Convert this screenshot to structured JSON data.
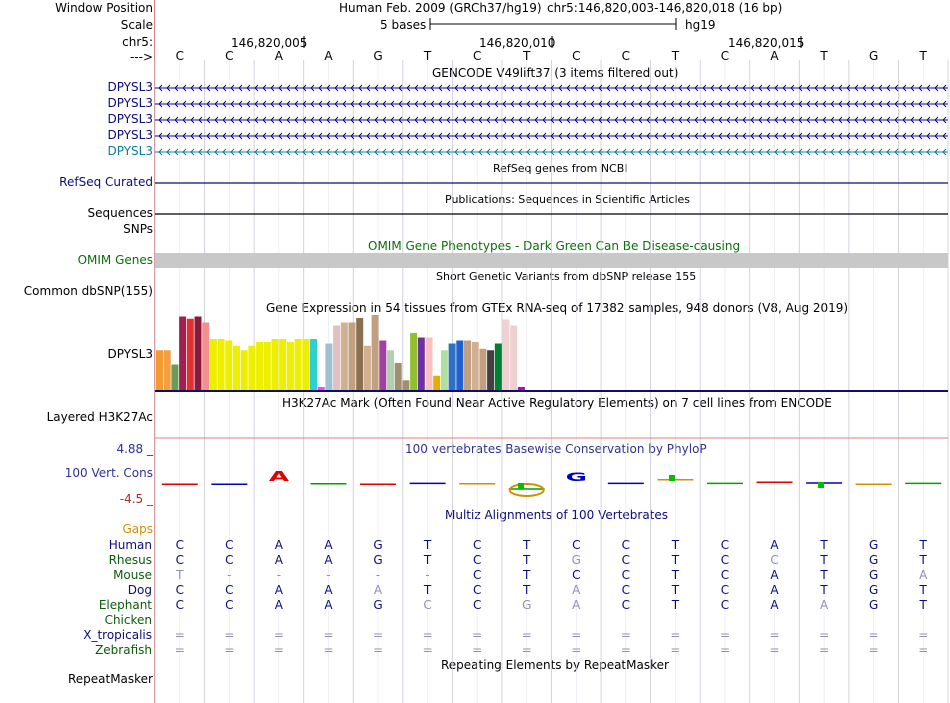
{
  "header": {
    "window_position_label": "Window Position",
    "assembly_text": "Human Feb. 2009 (GRCh37/hg19)",
    "position_text": "chr5:146,820,003-146,820,018 (16 bp)",
    "scale_label": "Scale",
    "scale_bar_text": "5 bases",
    "scale_assembly": "hg19",
    "chrom_label": "chr5:",
    "coord_ticks": [
      "146,820,005",
      "146,820,010",
      "146,820,015"
    ],
    "strand_label": "--->",
    "bases": [
      "C",
      "C",
      "A",
      "A",
      "G",
      "T",
      "C",
      "T",
      "C",
      "C",
      "T",
      "C",
      "A",
      "T",
      "G",
      "T"
    ]
  },
  "tracks": {
    "gencode": {
      "title": "GENCODE V49lift37 (3 items filtered out)",
      "items": [
        "DPYSL3",
        "DPYSL3",
        "DPYSL3",
        "DPYSL3",
        "DPYSL3"
      ],
      "colors": [
        "#0c0c78",
        "#0c0c78",
        "#0c0c78",
        "#0c0c78",
        "#0c7c96"
      ]
    },
    "refseq": {
      "title": "RefSeq genes from NCBI",
      "label": "RefSeq Curated",
      "color": "#0c0c78"
    },
    "pubs": {
      "title": "Publications: Sequences in Scientific Articles",
      "label": "Sequences"
    },
    "snps": {
      "label": "SNPs"
    },
    "omim": {
      "title": "OMIM Gene Phenotypes - Dark Green Can Be Disease-causing",
      "label": "OMIM Genes",
      "color": "#0a6e0a",
      "bar_color": "#c8c8c8"
    },
    "dbsnp": {
      "title": "Short Genetic Variants from dbSNP release 155",
      "label": "Common dbSNP(155)"
    },
    "gtex": {
      "title": "Gene Expression in 54 tissues from GTEx RNA-seq of 17382 samples, 948 donors (V8, Aug 2019)",
      "label": "DPYSL3",
      "bars": [
        {
          "v": 0.53,
          "c": "#f39b31"
        },
        {
          "v": 0.53,
          "c": "#f0a040"
        },
        {
          "v": 0.34,
          "c": "#6c9a5a"
        },
        {
          "v": 0.98,
          "c": "#a02050"
        },
        {
          "v": 0.95,
          "c": "#e03030"
        },
        {
          "v": 0.98,
          "c": "#8b1a3a"
        },
        {
          "v": 0.9,
          "c": "#f09090"
        },
        {
          "v": 0.68,
          "c": "#eeee00"
        },
        {
          "v": 0.68,
          "c": "#eeee00"
        },
        {
          "v": 0.66,
          "c": "#eeee00"
        },
        {
          "v": 0.59,
          "c": "#eeee00"
        },
        {
          "v": 0.53,
          "c": "#eeee00"
        },
        {
          "v": 0.59,
          "c": "#eeee00"
        },
        {
          "v": 0.64,
          "c": "#eeee00"
        },
        {
          "v": 0.64,
          "c": "#eeee00"
        },
        {
          "v": 0.68,
          "c": "#eeee00"
        },
        {
          "v": 0.68,
          "c": "#eeee00"
        },
        {
          "v": 0.64,
          "c": "#eeee00"
        },
        {
          "v": 0.68,
          "c": "#eeee00"
        },
        {
          "v": 0.68,
          "c": "#eeee00"
        },
        {
          "v": 0.68,
          "c": "#30d0d0"
        },
        {
          "v": 0.04,
          "c": "#ff40ff"
        },
        {
          "v": 0.62,
          "c": "#a0c0d0"
        },
        {
          "v": 0.86,
          "c": "#e0c0c0"
        },
        {
          "v": 0.9,
          "c": "#d0b090"
        },
        {
          "v": 0.9,
          "c": "#c0a080"
        },
        {
          "v": 0.96,
          "c": "#8b7050"
        },
        {
          "v": 0.59,
          "c": "#d0b090"
        },
        {
          "v": 1.0,
          "c": "#c0a080"
        },
        {
          "v": 0.66,
          "c": "#a040a0"
        },
        {
          "v": 0.53,
          "c": "#b0d0b0"
        },
        {
          "v": 0.36,
          "c": "#a09070"
        },
        {
          "v": 0.13,
          "c": "#a09070"
        },
        {
          "v": 0.76,
          "c": "#90c030"
        },
        {
          "v": 0.7,
          "c": "#7030a0"
        },
        {
          "v": 0.7,
          "c": "#fac0c0"
        },
        {
          "v": 0.19,
          "c": "#e0b000"
        },
        {
          "v": 0.53,
          "c": "#b0e0a0"
        },
        {
          "v": 0.62,
          "c": "#3070c0"
        },
        {
          "v": 0.66,
          "c": "#2060d0"
        },
        {
          "v": 0.66,
          "c": "#c0a080"
        },
        {
          "v": 0.64,
          "c": "#d0b090"
        },
        {
          "v": 0.55,
          "c": "#c0a080"
        },
        {
          "v": 0.53,
          "c": "#404040"
        },
        {
          "v": 0.62,
          "c": "#008030"
        },
        {
          "v": 0.94,
          "c": "#f0d0d0"
        },
        {
          "v": 0.86,
          "c": "#ecd0d0"
        },
        {
          "v": 0.04,
          "c": "#c000c0"
        }
      ]
    },
    "h3k27ac": {
      "title": "H3K27Ac Mark (Often Found Near Active Regulatory Elements) on 7 cell lines from ENCODE",
      "label": "Layered H3K27Ac"
    },
    "phylop": {
      "title": "100 vertebrates Basewise Conservation by PhyloP",
      "label": "100 Vert. Cons",
      "max": "4.88 _",
      "min": "-4.5 _",
      "color": "#303090",
      "scores": [
        -0.3,
        -0.3,
        1.6,
        -0.2,
        -0.3,
        -0.1,
        -0.2,
        -1.5,
        2.4,
        -0.1,
        0.8,
        -0.1,
        0.2,
        0.0,
        -0.3,
        -0.1
      ]
    },
    "multiz": {
      "title": "Multiz Alignments of 100 Vertebrates",
      "gaps_label": "Gaps",
      "species": [
        {
          "name": "Human",
          "color": "#0c0c78",
          "seq": [
            "C",
            "C",
            "A",
            "A",
            "G",
            "T",
            "C",
            "T",
            "C",
            "C",
            "T",
            "C",
            "A",
            "T",
            "G",
            "T"
          ],
          "dim": []
        },
        {
          "name": "Rhesus",
          "color": "#0c5a0c",
          "seq": [
            "C",
            "C",
            "A",
            "A",
            "G",
            "T",
            "C",
            "T",
            "G",
            "C",
            "T",
            "C",
            "C",
            "T",
            "G",
            "T"
          ],
          "dim": [
            8,
            12
          ]
        },
        {
          "name": "Mouse",
          "color": "#0c5a0c",
          "seq": [
            "T",
            "-",
            "-",
            "-",
            "-",
            "-",
            "C",
            "T",
            "C",
            "C",
            "T",
            "C",
            "A",
            "T",
            "G",
            "A"
          ],
          "dim": [
            0,
            1,
            2,
            3,
            4,
            5,
            15
          ]
        },
        {
          "name": "Dog",
          "color": "#0c0c78",
          "seq": [
            "C",
            "C",
            "A",
            "A",
            "A",
            "T",
            "C",
            "T",
            "A",
            "C",
            "T",
            "C",
            "A",
            "T",
            "G",
            "T"
          ],
          "dim": [
            4,
            8
          ]
        },
        {
          "name": "Elephant",
          "color": "#0c5a0c",
          "seq": [
            "C",
            "C",
            "A",
            "A",
            "G",
            "C",
            "C",
            "G",
            "A",
            "C",
            "T",
            "C",
            "A",
            "A",
            "G",
            "T"
          ],
          "dim": [
            5,
            7,
            8,
            13
          ]
        },
        {
          "name": "Chicken",
          "color": "#0c5a0c",
          "seq": [],
          "dim": []
        },
        {
          "name": "X_tropicalis",
          "color": "#0c0c78",
          "seq": [
            "=",
            "=",
            "=",
            "=",
            "=",
            "=",
            "=",
            "=",
            "=",
            "=",
            "=",
            "=",
            "=",
            "=",
            "=",
            "="
          ],
          "dim": [
            0,
            1,
            2,
            3,
            4,
            5,
            6,
            7,
            8,
            9,
            10,
            11,
            12,
            13,
            14,
            15
          ]
        },
        {
          "name": "Zebrafish",
          "color": "#0c5a0c",
          "seq": [
            "=",
            "=",
            "=",
            "=",
            "=",
            "=",
            "=",
            "=",
            "=",
            "=",
            "=",
            "=",
            "=",
            "=",
            "=",
            "="
          ],
          "dim": [
            0,
            1,
            2,
            3,
            4,
            5,
            6,
            7,
            8,
            9,
            10,
            11,
            12,
            13,
            14,
            15
          ]
        }
      ]
    },
    "rmsk": {
      "title": "Repeating Elements by RepeatMasker",
      "label": "RepeatMasker"
    }
  },
  "colors": {
    "gap_label": "#d28c00",
    "track_divider": "#e08080",
    "dim_base": "#9090b0"
  }
}
